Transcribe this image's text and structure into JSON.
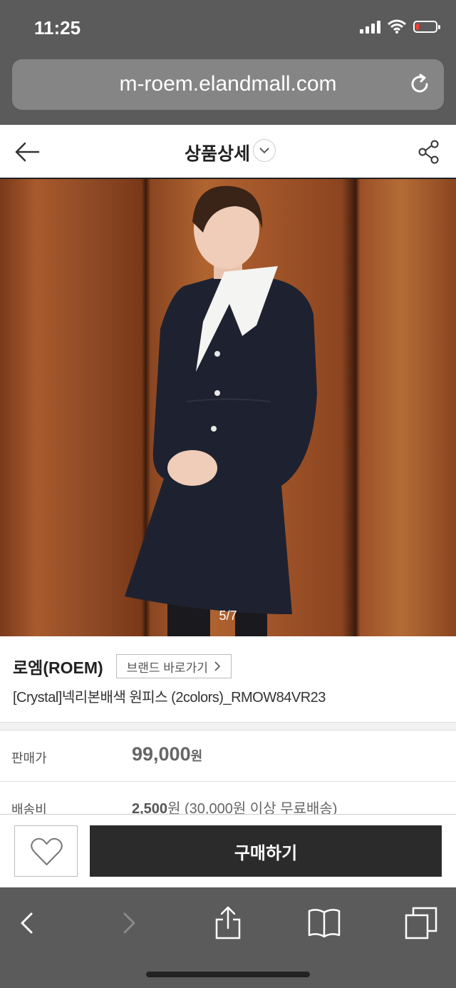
{
  "status_bar": {
    "time": "11:25",
    "battery_level": 0.15
  },
  "browser": {
    "url": "m-roem.elandmall.com"
  },
  "header": {
    "title": "상품상세"
  },
  "product": {
    "image_counter": "5/7",
    "brand": "로엠(ROEM)",
    "brand_link_label": "브랜드 바로가기",
    "title": "[Crystal]넥리본배색 원피스 (2colors)_RMOW84VR23",
    "price_label": "판매가",
    "price_amount": "99,000",
    "price_unit": "원",
    "shipping_label": "배송비",
    "shipping_amount": "2,500",
    "shipping_note": "원 (30,000원 이상 무료배송)"
  },
  "actions": {
    "buy_label": "구매하기"
  },
  "colors": {
    "chrome_gray": "#5b5b5b",
    "buy_button": "#2b2b2b",
    "battery_low": "#ff3b30"
  }
}
